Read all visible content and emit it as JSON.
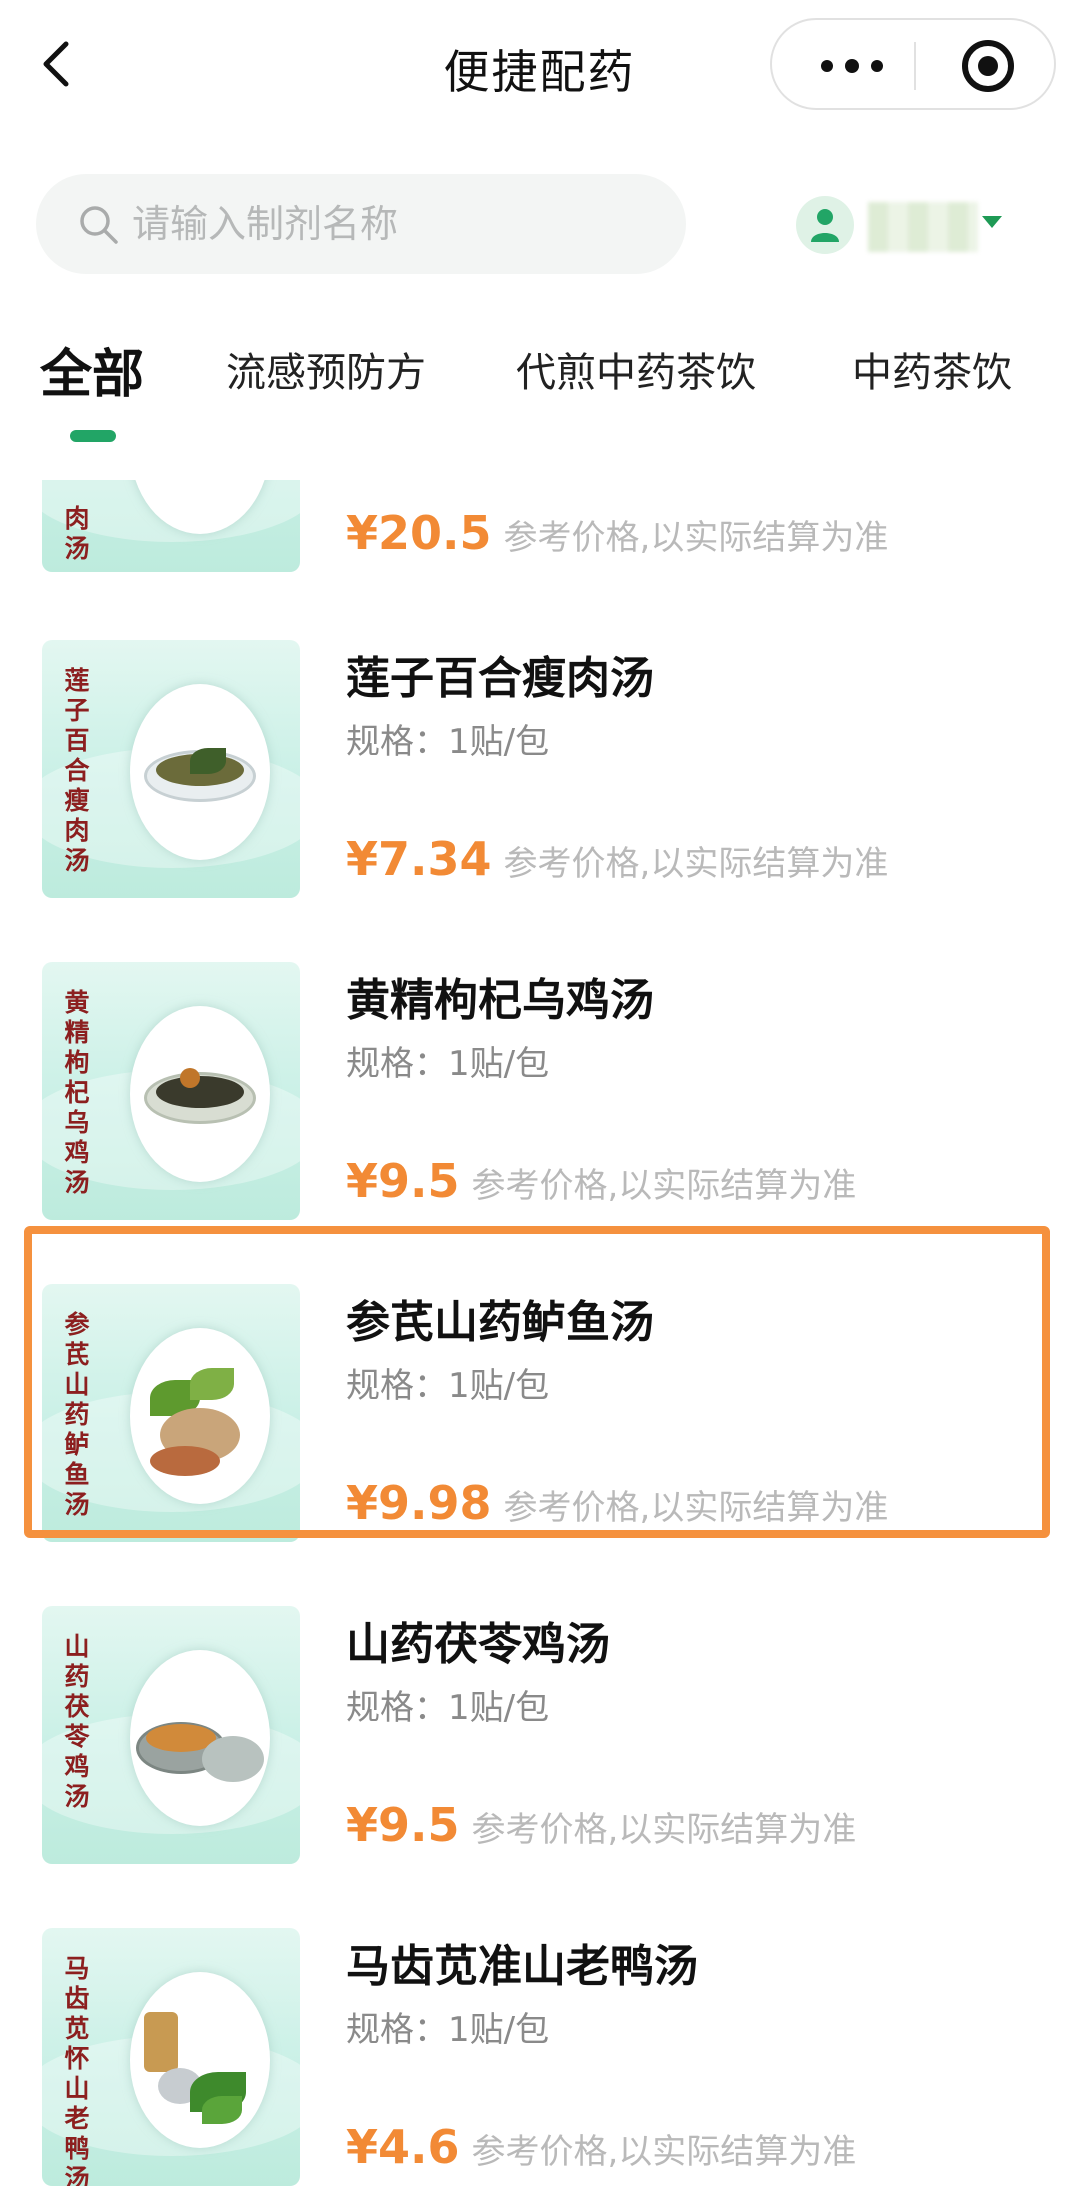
{
  "navbar": {
    "title": "便捷配药",
    "back_icon": "chevron-left-icon",
    "more_icon": "more-dots-icon",
    "close_icon": "target-circle-icon"
  },
  "search": {
    "placeholder": "请输入制剂名称",
    "value": ""
  },
  "user": {
    "name": "",
    "icon": "user-avatar-icon"
  },
  "tabs": [
    {
      "label": "全部",
      "active": true
    },
    {
      "label": "流感预防方",
      "active": false
    },
    {
      "label": "代煎中药茶饮",
      "active": false
    },
    {
      "label": "中药茶饮",
      "active": false
    }
  ],
  "products": [
    {
      "thumb_label": "肉汤",
      "name": "",
      "spec": "",
      "price": "¥20.5",
      "price_note": "参考价格,以实际结算为准"
    },
    {
      "thumb_label": "莲子百合瘦肉汤",
      "name": "莲子百合瘦肉汤",
      "spec": "规格：1贴/包",
      "price": "¥7.34",
      "price_note": "参考价格,以实际结算为准"
    },
    {
      "thumb_label": "黄精枸杞乌鸡汤",
      "name": "黄精枸杞乌鸡汤",
      "spec": "规格：1贴/包",
      "price": "¥9.5",
      "price_note": "参考价格,以实际结算为准"
    },
    {
      "thumb_label": "参芪山药鲈鱼汤",
      "name": "参芪山药鲈鱼汤",
      "spec": "规格：1贴/包",
      "price": "¥9.98",
      "price_note": "参考价格,以实际结算为准"
    },
    {
      "thumb_label": "山药茯苓鸡汤",
      "name": "山药茯苓鸡汤",
      "spec": "规格：1贴/包",
      "price": "¥9.5",
      "price_note": "参考价格,以实际结算为准"
    },
    {
      "thumb_label": "马齿苋怀山老鸭汤",
      "name": "马齿苋准山老鸭汤",
      "spec": "规格：1贴/包",
      "price": "¥4.6",
      "price_note": "参考价格,以实际结算为准"
    }
  ],
  "colors": {
    "accent_green": "#22a566",
    "price_orange": "#f28a35",
    "highlight_orange": "#f5913e",
    "thumb_red_text": "#8c1f1f"
  }
}
